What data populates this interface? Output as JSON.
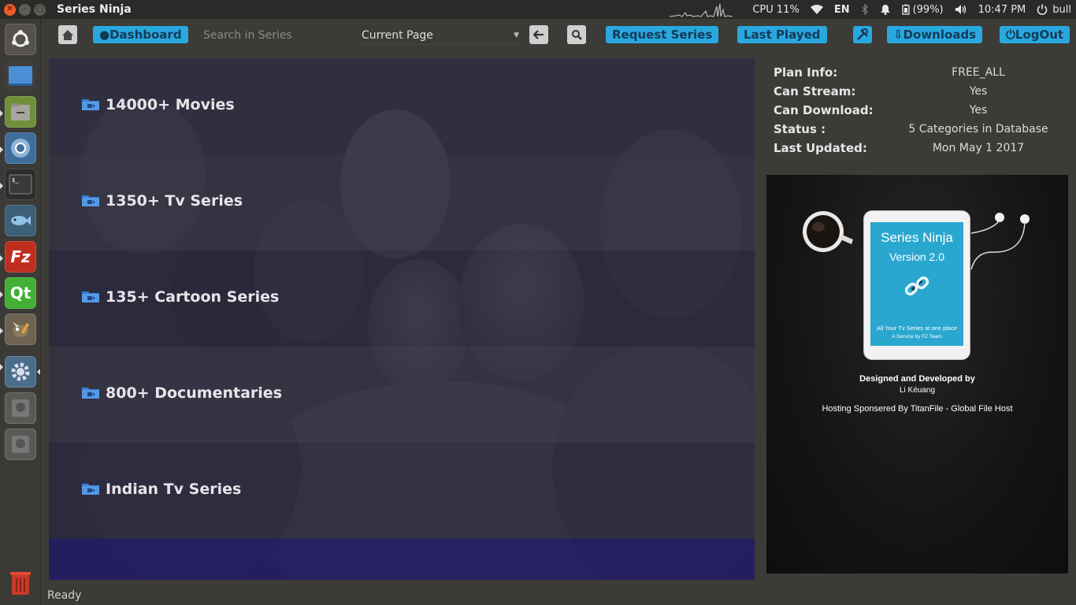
{
  "window": {
    "title": "Series Ninja"
  },
  "panel": {
    "cpu": "CPU 11%",
    "keyboard": "EN",
    "battery": "(99%)",
    "time": "10:47 PM",
    "user": "bull"
  },
  "toolbar": {
    "dashboard_label": "●Dashboard",
    "search_placeholder": "Search in Series",
    "select_value": "Current Page",
    "request_label": "Request Series",
    "last_played_label": "Last Played",
    "downloads_label": "⇩Downloads",
    "logout_label": "⏻LogOut"
  },
  "categories": [
    {
      "label": "14000+ Movies"
    },
    {
      "label": "1350+ Tv Series"
    },
    {
      "label": "135+ Cartoon Series"
    },
    {
      "label": "800+ Documentaries"
    },
    {
      "label": "Indian Tv Series"
    }
  ],
  "info": {
    "plan_key": "Plan Info:",
    "plan_val": "FREE_ALL",
    "stream_key": "Can Stream:",
    "stream_val": "Yes",
    "download_key": "Can Download:",
    "download_val": "Yes",
    "status_key": "Status :",
    "status_val": "5 Categories in Database",
    "updated_key": "Last Updated:",
    "updated_val": "Mon May 1 2017"
  },
  "promo": {
    "app_name": "Series Ninja",
    "version": "Version 2.0",
    "tagline": "All Your Tv Series at one place",
    "service": "A Service by FZ Team",
    "designed_by": "Designed and Developed by",
    "developer": "Li Kéuang",
    "hosting": "Hosting Sponsered By TitanFile - Global File Host"
  },
  "status": {
    "text": "Ready"
  },
  "colors": {
    "accent": "#29a8e0",
    "close": "#f05a28"
  },
  "launcher": {
    "icons": [
      "ubuntu-logo-icon",
      "desktop-icon",
      "files-icon",
      "chromium-icon",
      "terminal-icon",
      "fish-icon",
      "filezilla-icon",
      "qt-creator-icon",
      "gimp-icon",
      "settings-icon",
      "disk-icon",
      "disk-icon",
      "trash-icon"
    ],
    "filezilla_glyph": "Fz",
    "qt_glyph": "Qt"
  }
}
